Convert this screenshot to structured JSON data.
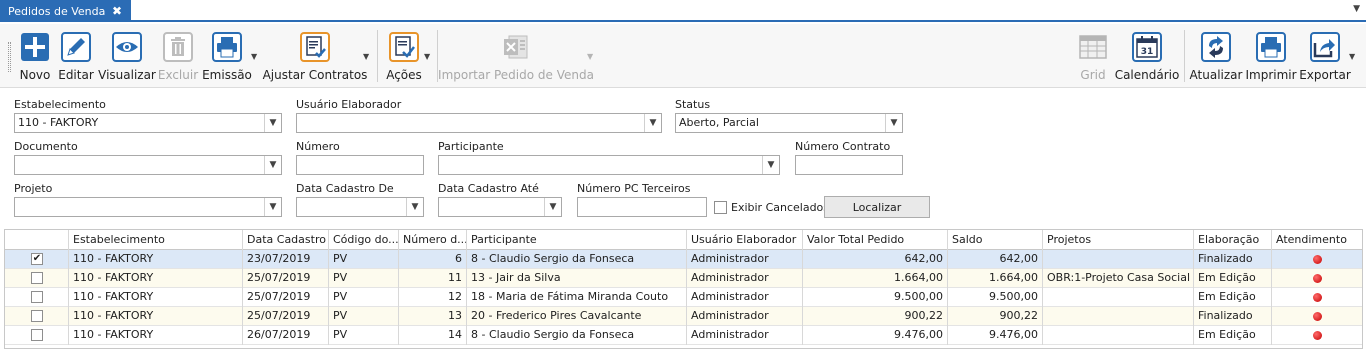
{
  "tab": {
    "title": "Pedidos de Venda",
    "close": "✖"
  },
  "toolbar": {
    "buttons": {
      "novo": "Novo",
      "editar": "Editar",
      "visualizar": "Visualizar",
      "excluir": "Excluir",
      "emissao": "Emissão",
      "ajustar": "Ajustar Contratos",
      "acoes": "Ações",
      "importar": "Importar Pedido de Venda",
      "grid": "Grid",
      "calendario": "Calendário",
      "atualizar": "Atualizar",
      "imprimir": "Imprimir",
      "exportar": "Exportar"
    },
    "calendar_day": "31",
    "icons": [
      "plus-icon",
      "pencil-icon",
      "eye-icon",
      "trash-icon",
      "printer-icon",
      "contract-check-icon",
      "actions-check-icon",
      "excel-icon",
      "grid-icon",
      "calendar-icon",
      "refresh-icon",
      "printer-icon",
      "export-icon"
    ]
  },
  "filters": {
    "estabelecimento": {
      "label": "Estabelecimento",
      "value": "110 - FAKTORY"
    },
    "usuario": {
      "label": "Usuário Elaborador",
      "value": ""
    },
    "status": {
      "label": "Status",
      "value": "Aberto, Parcial"
    },
    "documento": {
      "label": "Documento",
      "value": ""
    },
    "numero": {
      "label": "Número",
      "value": ""
    },
    "participante": {
      "label": "Participante",
      "value": ""
    },
    "numero_contrato": {
      "label": "Número Contrato",
      "value": ""
    },
    "projeto": {
      "label": "Projeto",
      "value": ""
    },
    "data_de": {
      "label": "Data Cadastro De",
      "value": ""
    },
    "data_ate": {
      "label": "Data Cadastro Até",
      "value": ""
    },
    "numero_pc": {
      "label": "Número PC Terceiros",
      "value": ""
    },
    "exibir_cancelados": "Exibir Cancelados",
    "localizar": "Localizar"
  },
  "grid": {
    "columns": [
      "Estabelecimento",
      "Data Cadastro",
      "Código do...",
      "Número d...",
      "Participante",
      "Usuário Elaborador",
      "Valor Total Pedido",
      "Saldo",
      "Projetos",
      "Elaboração",
      "Atendimento"
    ],
    "rows": [
      {
        "checked": true,
        "estab": "110 - FAKTORY",
        "data": "23/07/2019",
        "codigo": "PV",
        "numero": "6",
        "participante": "8 - Claudio Sergio da Fonseca",
        "usuario": "Administrador",
        "valor": "642,00",
        "saldo": "642,00",
        "projetos": "",
        "elaboracao": "Finalizado"
      },
      {
        "checked": false,
        "estab": "110 - FAKTORY",
        "data": "25/07/2019",
        "codigo": "PV",
        "numero": "11",
        "participante": "13 - Jair da Silva",
        "usuario": "Administrador",
        "valor": "1.664,00",
        "saldo": "1.664,00",
        "projetos": "OBR:1-Projeto Casa Social",
        "elaboracao": "Em Edição"
      },
      {
        "checked": false,
        "estab": "110 - FAKTORY",
        "data": "25/07/2019",
        "codigo": "PV",
        "numero": "12",
        "participante": "18 - Maria de Fátima Miranda Couto",
        "usuario": "Administrador",
        "valor": "9.500,00",
        "saldo": "9.500,00",
        "projetos": "",
        "elaboracao": "Em Edição"
      },
      {
        "checked": false,
        "estab": "110 - FAKTORY",
        "data": "25/07/2019",
        "codigo": "PV",
        "numero": "13",
        "participante": "20 - Frederico Pires Cavalcante",
        "usuario": "Administrador",
        "valor": "900,22",
        "saldo": "900,22",
        "projetos": "",
        "elaboracao": "Finalizado"
      },
      {
        "checked": false,
        "estab": "110 - FAKTORY",
        "data": "26/07/2019",
        "codigo": "PV",
        "numero": "14",
        "participante": "8 - Claudio Sergio da Fonseca",
        "usuario": "Administrador",
        "valor": "9.476,00",
        "saldo": "9.476,00",
        "projetos": "",
        "elaboracao": "Em Edição"
      }
    ],
    "status_dot_color": "#d40000"
  },
  "colors": {
    "accent": "#2b6cb5",
    "selected_row": "#dce8f7",
    "alt_row": "#fdfbee",
    "icon_blue": "#2a6db3"
  }
}
